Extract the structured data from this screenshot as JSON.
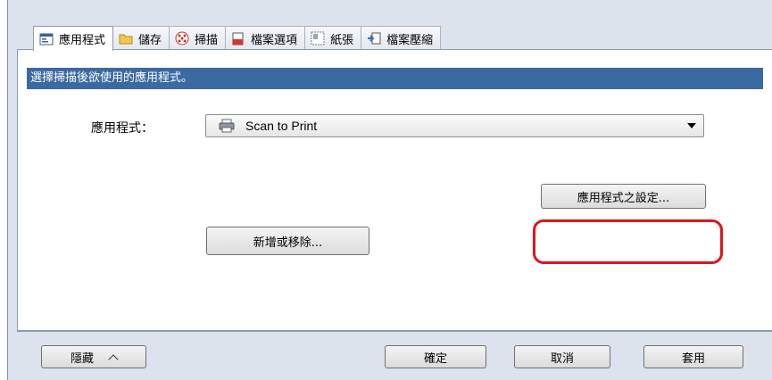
{
  "tabs": [
    {
      "label": "應用程式",
      "icon": "application-icon",
      "active": true
    },
    {
      "label": "儲存",
      "icon": "folder-icon",
      "active": false
    },
    {
      "label": "掃描",
      "icon": "scan-icon",
      "active": false
    },
    {
      "label": "檔案選項",
      "icon": "file-options-icon",
      "active": false
    },
    {
      "label": "紙張",
      "icon": "paper-icon",
      "active": false
    },
    {
      "label": "檔案壓縮",
      "icon": "file-compression-icon",
      "active": false
    }
  ],
  "panel": {
    "header": "選擇掃描後欲使用的應用程式。",
    "application_label": "應用程式：",
    "application_value": "Scan to Print",
    "app_settings_button": "應用程式之設定...",
    "add_remove_button": "新增或移除..."
  },
  "footer": {
    "hide_button": "隱藏",
    "ok_button": "確定",
    "cancel_button": "取消",
    "apply_button": "套用"
  },
  "colors": {
    "header_bar": "#3b6aa3",
    "highlight": "#e0141e"
  }
}
